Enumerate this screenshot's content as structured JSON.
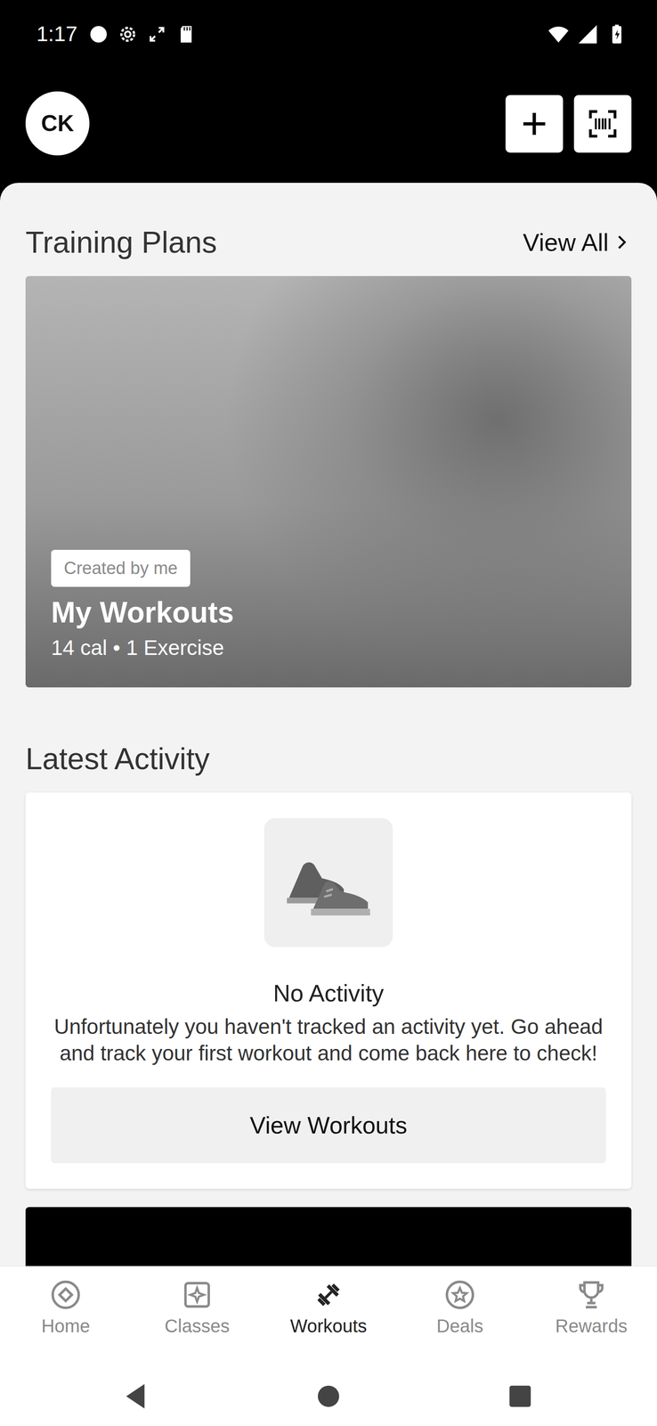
{
  "status_bar": {
    "time": "1:17"
  },
  "header": {
    "avatar": "CK"
  },
  "training_plans": {
    "title": "Training Plans",
    "view_all": "View All",
    "plan": {
      "badge": "Created by me",
      "title": "My Workouts",
      "meta": "14 cal • 1 Exercise"
    }
  },
  "latest_activity": {
    "title": "Latest Activity",
    "empty_title": "No Activity",
    "empty_text": "Unfortunately you haven't tracked an activity yet. Go ahead and track your first workout and come back here to check!",
    "button": "View Workouts"
  },
  "bottom_nav": [
    {
      "label": "Home",
      "selected": false
    },
    {
      "label": "Classes",
      "selected": false
    },
    {
      "label": "Workouts",
      "selected": true
    },
    {
      "label": "Deals",
      "selected": false
    },
    {
      "label": "Rewards",
      "selected": false
    }
  ]
}
